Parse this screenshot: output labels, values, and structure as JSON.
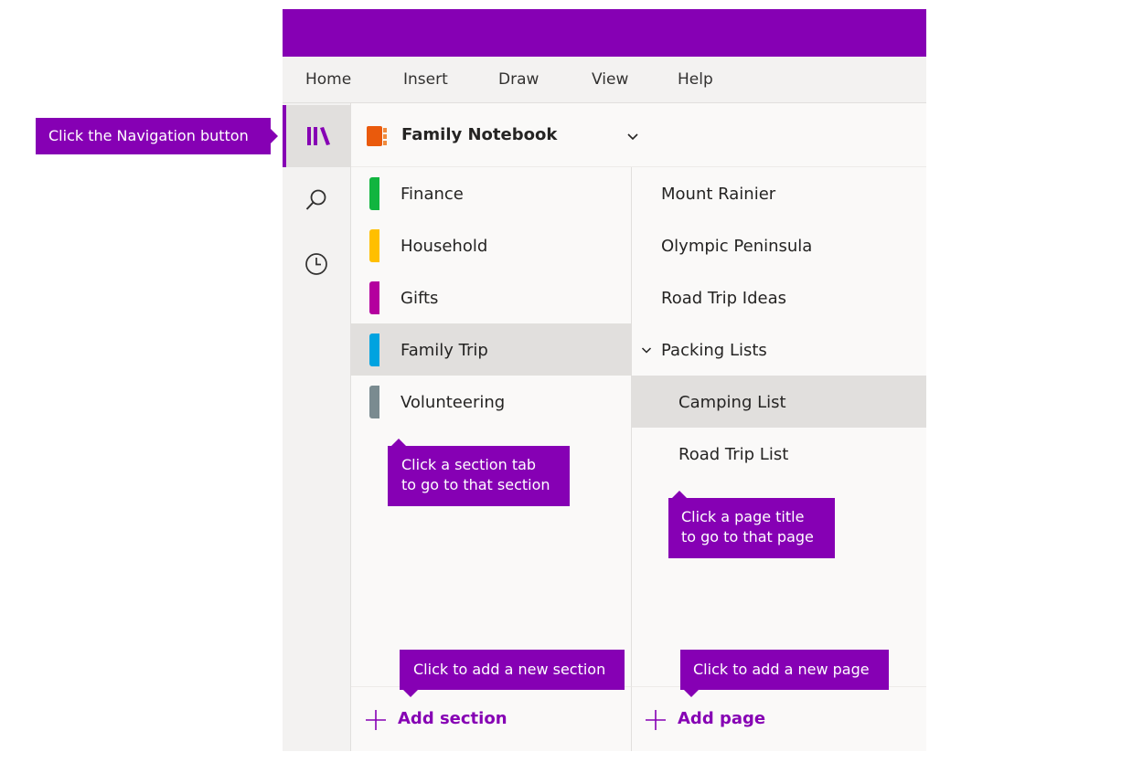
{
  "colors": {
    "accent": "#8600b4",
    "finance": "#11b53f",
    "household": "#ffbf00",
    "gifts": "#b4009e",
    "family_trip": "#00a3e0",
    "volunteering": "#7a8b90",
    "notebook_icon": "#ea5a0c"
  },
  "menu": [
    "Home",
    "Insert",
    "Draw",
    "View",
    "Help"
  ],
  "nav": {
    "icons": [
      "library-icon",
      "search-icon",
      "clock-icon"
    ]
  },
  "notebook": {
    "title": "Family Notebook"
  },
  "sections": [
    {
      "label": "Finance",
      "color": "#11b53f"
    },
    {
      "label": "Household",
      "color": "#ffbf00"
    },
    {
      "label": "Gifts",
      "color": "#b4009e"
    },
    {
      "label": "Family Trip",
      "color": "#00a3e0"
    },
    {
      "label": "Volunteering",
      "color": "#7a8b90"
    }
  ],
  "pages": [
    {
      "label": "Mount Rainier"
    },
    {
      "label": "Olympic Peninsula"
    },
    {
      "label": "Road Trip Ideas"
    },
    {
      "label": "Packing Lists"
    },
    {
      "label": "Camping List"
    },
    {
      "label": "Road Trip List"
    }
  ],
  "add_section_label": "Add section",
  "add_page_label": "Add page",
  "callouts": {
    "navigation": "Click the Navigation button",
    "section_line1": "Click a section tab",
    "section_line2": "to go to that section",
    "page_line1": "Click a page title",
    "page_line2": "to go to that page",
    "add_section": "Click to add a new section",
    "add_page": "Click to add a new page"
  }
}
